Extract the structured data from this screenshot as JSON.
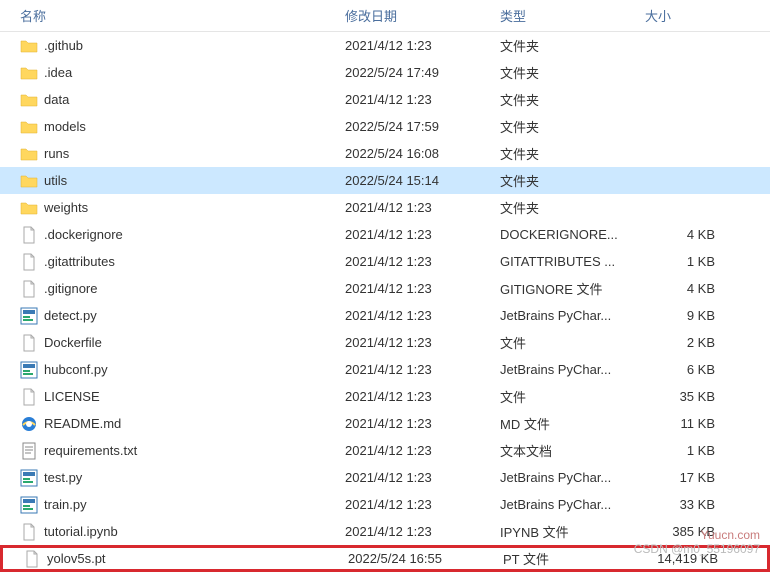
{
  "columns": {
    "name": "名称",
    "date": "修改日期",
    "type": "类型",
    "size": "大小"
  },
  "rows": [
    {
      "icon": "folder",
      "name": ".github",
      "date": "2021/4/12 1:23",
      "type": "文件夹",
      "size": ""
    },
    {
      "icon": "folder",
      "name": ".idea",
      "date": "2022/5/24 17:49",
      "type": "文件夹",
      "size": ""
    },
    {
      "icon": "folder",
      "name": "data",
      "date": "2021/4/12 1:23",
      "type": "文件夹",
      "size": ""
    },
    {
      "icon": "folder",
      "name": "models",
      "date": "2022/5/24 17:59",
      "type": "文件夹",
      "size": ""
    },
    {
      "icon": "folder",
      "name": "runs",
      "date": "2022/5/24 16:08",
      "type": "文件夹",
      "size": ""
    },
    {
      "icon": "folder",
      "name": "utils",
      "date": "2022/5/24 15:14",
      "type": "文件夹",
      "size": "",
      "selected": true
    },
    {
      "icon": "folder",
      "name": "weights",
      "date": "2021/4/12 1:23",
      "type": "文件夹",
      "size": ""
    },
    {
      "icon": "file",
      "name": ".dockerignore",
      "date": "2021/4/12 1:23",
      "type": "DOCKERIGNORE...",
      "size": "4 KB"
    },
    {
      "icon": "file",
      "name": ".gitattributes",
      "date": "2021/4/12 1:23",
      "type": "GITATTRIBUTES ...",
      "size": "1 KB"
    },
    {
      "icon": "file",
      "name": ".gitignore",
      "date": "2021/4/12 1:23",
      "type": "GITIGNORE 文件",
      "size": "4 KB"
    },
    {
      "icon": "pycharm",
      "name": "detect.py",
      "date": "2021/4/12 1:23",
      "type": "JetBrains PyChar...",
      "size": "9 KB"
    },
    {
      "icon": "file",
      "name": "Dockerfile",
      "date": "2021/4/12 1:23",
      "type": "文件",
      "size": "2 KB"
    },
    {
      "icon": "pycharm",
      "name": "hubconf.py",
      "date": "2021/4/12 1:23",
      "type": "JetBrains PyChar...",
      "size": "6 KB"
    },
    {
      "icon": "file",
      "name": "LICENSE",
      "date": "2021/4/12 1:23",
      "type": "文件",
      "size": "35 KB"
    },
    {
      "icon": "ie",
      "name": "README.md",
      "date": "2021/4/12 1:23",
      "type": "MD 文件",
      "size": "11 KB"
    },
    {
      "icon": "text",
      "name": "requirements.txt",
      "date": "2021/4/12 1:23",
      "type": "文本文档",
      "size": "1 KB"
    },
    {
      "icon": "pycharm",
      "name": "test.py",
      "date": "2021/4/12 1:23",
      "type": "JetBrains PyChar...",
      "size": "17 KB"
    },
    {
      "icon": "pycharm",
      "name": "train.py",
      "date": "2021/4/12 1:23",
      "type": "JetBrains PyChar...",
      "size": "33 KB"
    },
    {
      "icon": "file",
      "name": "tutorial.ipynb",
      "date": "2021/4/12 1:23",
      "type": "IPYNB 文件",
      "size": "385 KB"
    },
    {
      "icon": "file",
      "name": "yolov5s.pt",
      "date": "2022/5/24 16:55",
      "type": "PT 文件",
      "size": "14,419 KB",
      "highlight": true
    }
  ],
  "watermark": {
    "line1": "Yuucn.com",
    "line2": "CSDN @m0_55196097"
  }
}
